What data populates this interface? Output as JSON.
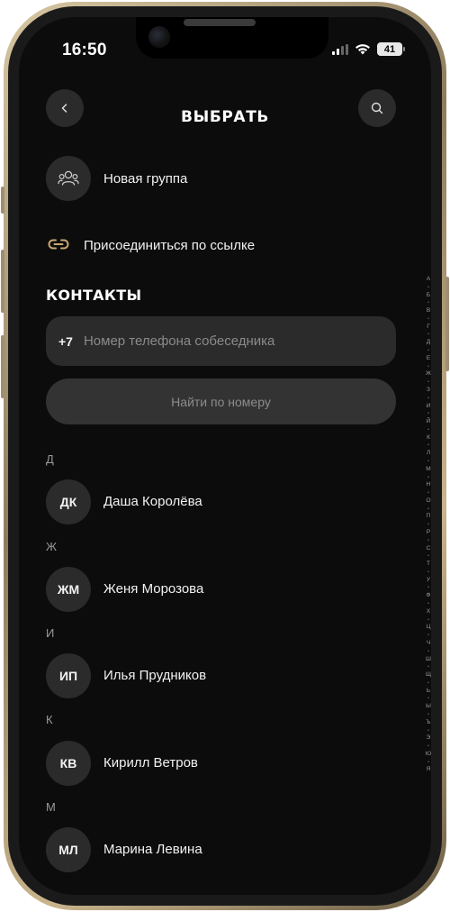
{
  "status": {
    "time": "16:50",
    "battery": "41"
  },
  "header": {
    "title": "ВЫБРАТЬ"
  },
  "actions": {
    "new_group": "Новая группа",
    "join_link": "Присоединиться по ссылке"
  },
  "contacts": {
    "section_title": "КОНТАКТЫ",
    "phone_prefix": "+7",
    "phone_placeholder": "Номер телефона собеседника",
    "find_button": "Найти по номеру",
    "groups": [
      {
        "letter": "Д",
        "initials": "ДК",
        "name": "Даша Королёва"
      },
      {
        "letter": "Ж",
        "initials": "ЖМ",
        "name": "Женя Морозова"
      },
      {
        "letter": "И",
        "initials": "ИП",
        "name": "Илья Прудников"
      },
      {
        "letter": "К",
        "initials": "КВ",
        "name": "Кирилл Ветров"
      },
      {
        "letter": "М",
        "initials": "МЛ",
        "name": "Марина Левина"
      }
    ]
  },
  "alphabet": [
    "А",
    "Б",
    "В",
    "Г",
    "Д",
    "Е",
    "Ж",
    "З",
    "И",
    "Й",
    "К",
    "Л",
    "М",
    "Н",
    "О",
    "П",
    "Р",
    "С",
    "Т",
    "У",
    "Ф",
    "Х",
    "Ц",
    "Ч",
    "Ш",
    "Щ",
    "Ь",
    "Ы",
    "Ъ",
    "Э",
    "Ю",
    "Я"
  ],
  "colors": {
    "background": "#0c0c0c",
    "surface": "#2b2b2b",
    "link_icon": "#c9a773"
  }
}
